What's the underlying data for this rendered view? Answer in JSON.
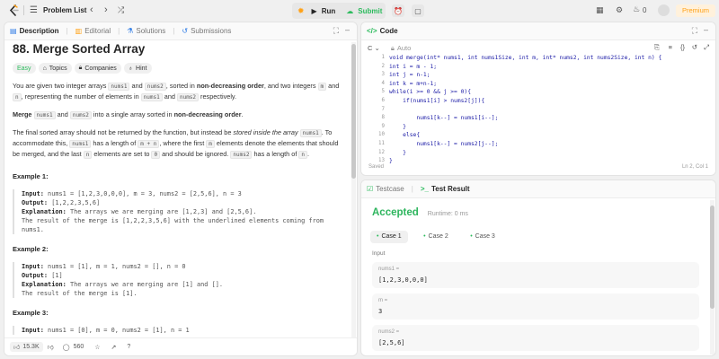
{
  "topbar": {
    "problem_list": "Problem List",
    "run": "Run",
    "submit": "Submit",
    "streak": "0",
    "premium": "Premium"
  },
  "desc": {
    "tabs": [
      "Description",
      "Editorial",
      "Solutions",
      "Submissions"
    ],
    "title": "88. Merge Sorted Array",
    "chips": [
      "Easy",
      "Topics",
      "Companies",
      "Hint"
    ],
    "p1": [
      {
        "t": "You are given two integer arrays "
      },
      {
        "c": "nums1"
      },
      {
        "t": " and "
      },
      {
        "c": "nums2"
      },
      {
        "t": ", sorted in "
      },
      {
        "b": "non-decreasing order"
      },
      {
        "t": ", and two integers "
      },
      {
        "c": "m"
      },
      {
        "t": " and "
      },
      {
        "c": "n"
      },
      {
        "t": ", representing the number of elements in "
      },
      {
        "c": "nums1"
      },
      {
        "t": " and "
      },
      {
        "c": "nums2"
      },
      {
        "t": " respectively."
      }
    ],
    "p2": [
      {
        "b": "Merge"
      },
      {
        "t": " "
      },
      {
        "c": "nums1"
      },
      {
        "t": " and "
      },
      {
        "c": "nums2"
      },
      {
        "t": " into a single array sorted in "
      },
      {
        "b": "non-decreasing order"
      },
      {
        "t": "."
      }
    ],
    "p3": [
      {
        "t": "The final sorted array should not be returned by the function, but instead be "
      },
      {
        "i": "stored inside the array"
      },
      {
        "t": " "
      },
      {
        "c": "nums1"
      },
      {
        "t": ". To accommodate this, "
      },
      {
        "c": "nums1"
      },
      {
        "t": " has a length of "
      },
      {
        "c": "m + n"
      },
      {
        "t": ", where the first "
      },
      {
        "c": "m"
      },
      {
        "t": " elements denote the elements that should be merged, and the last "
      },
      {
        "c": "n"
      },
      {
        "t": " elements are set to "
      },
      {
        "c": "0"
      },
      {
        "t": " and should be ignored. "
      },
      {
        "c": "nums2"
      },
      {
        "t": " has a length of "
      },
      {
        "c": "n"
      },
      {
        "t": "."
      }
    ],
    "examples": [
      {
        "h": "Example 1:",
        "lines": [
          [
            "Input:",
            " nums1 = [1,2,3,0,0,0], m = 3, nums2 = [2,5,6], n = 3"
          ],
          [
            "Output:",
            " [1,2,2,3,5,6]"
          ],
          [
            "Explanation:",
            " The arrays we are merging are [1,2,3] and [2,5,6]."
          ],
          [
            "",
            " The result of the merge is [1,2,2,3,5,6] with the underlined elements coming from"
          ],
          [
            "",
            " nums1."
          ]
        ]
      },
      {
        "h": "Example 2:",
        "lines": [
          [
            "Input:",
            " nums1 = [1], m = 1, nums2 = [], n = 0"
          ],
          [
            "Output:",
            " [1]"
          ],
          [
            "Explanation:",
            " The arrays we are merging are [1] and []."
          ],
          [
            "",
            " The result of the merge is [1]."
          ]
        ]
      },
      {
        "h": "Example 3:",
        "lines": [
          [
            "Input:",
            " nums1 = [0], m = 0, nums2 = [1], n = 1"
          ]
        ]
      }
    ],
    "likes": "15.3K",
    "comments": "560"
  },
  "code": {
    "header": "Code",
    "lang": "C",
    "mode": "Auto",
    "saved": "Saved",
    "cursor": "Ln 2, Col 1",
    "lines": [
      "void merge(int* nums1, int nums1Size, int m, int* nums2, int nums2Size, int n) {",
      "int i = m - 1;",
      "int j = n-1;",
      "int k = m+n-1;",
      "while(i >= 0 && j >= 0){",
      "    if(nums1[i] > nums2[j]){",
      "",
      "        nums1[k--] = nums1[i--];",
      "    }",
      "    else{",
      "        nums1[k--] = nums2[j--];",
      "    }",
      "}"
    ]
  },
  "result": {
    "tabs": [
      "Testcase",
      "Test Result"
    ],
    "status": "Accepted",
    "runtime": "Runtime: 0 ms",
    "cases": [
      "Case 1",
      "Case 2",
      "Case 3"
    ],
    "input_label": "Input",
    "fields": [
      {
        "label": "nums1 =",
        "value": "[1,2,3,0,0,0]"
      },
      {
        "label": "m =",
        "value": "3"
      },
      {
        "label": "nums2 =",
        "value": "[2,5,6]"
      }
    ]
  },
  "colors": {
    "accent": "#2cbb5d",
    "accepted": "#2db55d",
    "premium": "#ffa116"
  }
}
